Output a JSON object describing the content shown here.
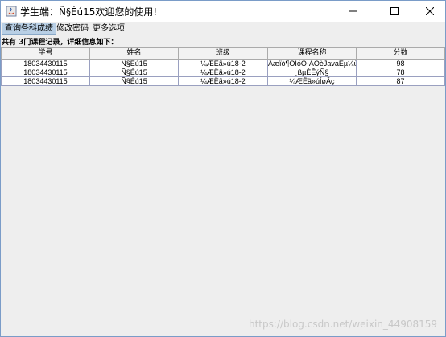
{
  "window": {
    "title": "学生端：Ñ§Éú15欢迎您的使用!"
  },
  "menubar": {
    "items": [
      {
        "label": "查询各科成绩",
        "active": true
      },
      {
        "label": "修改密码",
        "active": false
      },
      {
        "label": "更多选项",
        "active": false
      }
    ]
  },
  "info": "共有 3门课程记录，详细信息如下：",
  "table": {
    "headers": [
      "学号",
      "姓名",
      "班级",
      "课程名称",
      "分数"
    ],
    "rows": [
      [
        "18034430115",
        "Ñ§Éú15",
        "¼ÆËã»ú18-2",
        "Ãæïò¶ÔÏóÕ-ÀÖèJavaÊµ¼ù",
        "98"
      ],
      [
        "18034430115",
        "Ñ§Éú15",
        "¼ÆËã»ú18-2",
        "¸ßµÈÊýÑ§",
        "78"
      ],
      [
        "18034430115",
        "Ñ§Éú15",
        "¼ÆËã»ú18-2",
        "¼ÆËã»úÍøÂç",
        "87"
      ]
    ]
  },
  "watermark": "https://blog.csdn.net/weixin_44908159",
  "colors": {
    "menu_active_bg": "#b8cfe5",
    "window_bg": "#eeeeee",
    "grid": "#9aa0c0"
  }
}
